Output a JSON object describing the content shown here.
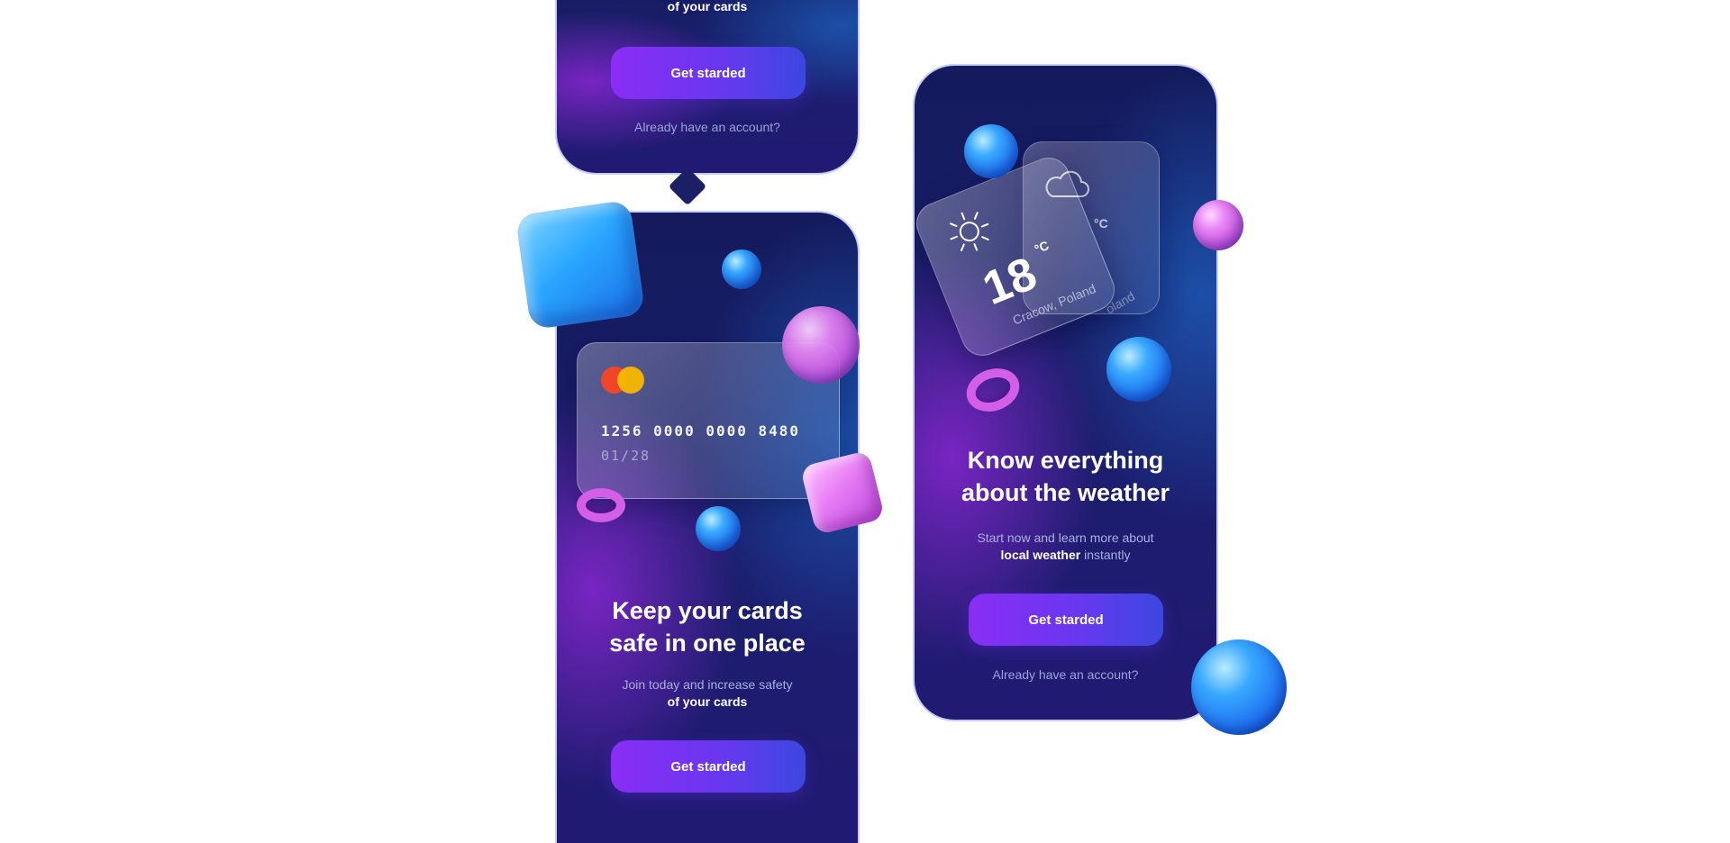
{
  "top_screen": {
    "subtitle_bold": "of your cards",
    "button_label": "Get starded",
    "account_link": "Already have an account?"
  },
  "cards_screen": {
    "card": {
      "number": "1256 0000 0000 8480",
      "expiry": "01/28"
    },
    "title_line1": "Keep your cards",
    "title_line2": "safe in one place",
    "subtitle": "Join today and increase safety",
    "subtitle_bold": "of your cards",
    "button_label": "Get starded"
  },
  "weather_screen": {
    "front_card": {
      "temperature": "18",
      "unit": "°C",
      "location": "Cracow, Poland"
    },
    "back_card": {
      "unit": "°C",
      "location": "oland"
    },
    "title_line1": "Know everything",
    "title_line2": "about the weather",
    "subtitle": "Start now and learn more about",
    "subtitle_bold": "local weather",
    "subtitle_rest": " instantly",
    "button_label": "Get starded",
    "account_link": "Already have an account?"
  },
  "icons": [
    "sun-icon",
    "cloud-icon",
    "mastercard-logo"
  ],
  "colors": {
    "background_dark": "#1a1f6b",
    "accent_purple": "#8a2df5",
    "accent_blue": "#3b47e0",
    "sphere_blue": "#2aa6ff",
    "sphere_pink": "#e77df5"
  }
}
